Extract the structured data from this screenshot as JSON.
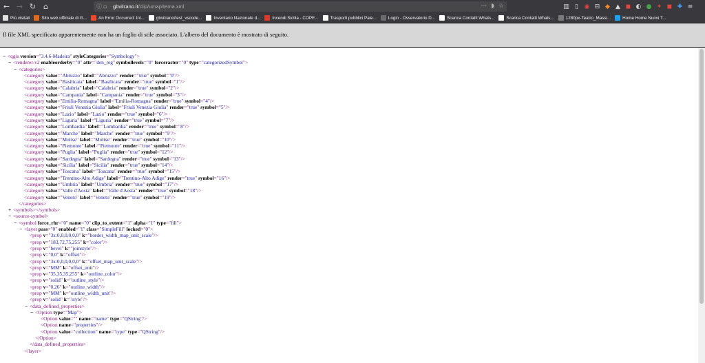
{
  "toolbar": {
    "url_domain": "gbvitrano.it",
    "url_path": "/clip/umap/tema.xml"
  },
  "bookmarks": [
    {
      "label": "Più visitati",
      "color": "#e1e1e1",
      "icon": "gear-icon"
    },
    {
      "label": "Sito web ufficiale di G...",
      "color": "#e06b1f",
      "icon": "site-icon"
    },
    {
      "label": "An Error Occurred: Int...",
      "color": "#e94b2c",
      "icon": "error-icon"
    },
    {
      "label": "gbvitrano/test_vscode...",
      "color": "#ffffff",
      "icon": "github-icon"
    },
    {
      "label": "Inventario Nazionale d...",
      "color": "#ffffff",
      "icon": "globe-icon"
    },
    {
      "label": "Incendi Sicilia - COPE...",
      "color": "#d93a2b",
      "icon": "fire-icon"
    },
    {
      "label": "Trasporti pubblici Pale...",
      "color": "#ffffff",
      "icon": "globe-icon"
    },
    {
      "label": "Login - Osservatorio D...",
      "color": "#6b6b6b",
      "icon": "page-icon"
    },
    {
      "label": "Scarica Contatti Whats...",
      "color": "#ffffff",
      "icon": "globe-icon"
    },
    {
      "label": "Scarica Contatti Whats...",
      "color": "#ffffff",
      "icon": "globe-icon"
    },
    {
      "label": "1280px-Teatro_Massi...",
      "color": "#7b7b7b",
      "icon": "image-icon"
    },
    {
      "label": "Home Home Nuovi T...",
      "color": "#1da1f2",
      "icon": "twitter-icon"
    }
  ],
  "infobar": {
    "message": "Il file XML specificato apparentemente non ha un foglio di stile associato. L'albero del documento è mostrato di seguito."
  },
  "xml": {
    "categories": [
      {
        "value": "Abruzzo",
        "symbol": "0"
      },
      {
        "value": "Basilicata",
        "symbol": "1"
      },
      {
        "value": "Calabria",
        "symbol": "2"
      },
      {
        "value": "Campania",
        "symbol": "3"
      },
      {
        "value": "Emilia-Romagna",
        "symbol": "4"
      },
      {
        "value": "Friuli Venezia Giulia",
        "symbol": "5"
      },
      {
        "value": "Lazio",
        "symbol": "6"
      },
      {
        "value": "Liguria",
        "symbol": "7"
      },
      {
        "value": "Lombardia",
        "symbol": "8"
      },
      {
        "value": "Marche",
        "symbol": "9"
      },
      {
        "value": "Molise",
        "symbol": "10"
      },
      {
        "value": "Piemonte",
        "symbol": "11"
      },
      {
        "value": "Puglia",
        "symbol": "12"
      },
      {
        "value": "Sardegna",
        "symbol": "13"
      },
      {
        "value": "Sicilia",
        "symbol": "14"
      },
      {
        "value": "Toscana",
        "symbol": "15"
      },
      {
        "value": "Trentino-Alto Adige",
        "symbol": "16"
      },
      {
        "value": "Umbria",
        "symbol": "17"
      },
      {
        "value": "Valle d'Aosta",
        "symbol": "18"
      },
      {
        "value": "Veneto",
        "symbol": "19"
      }
    ],
    "props": [
      {
        "v": "3x:0,0,0,0,0,0",
        "k": "border_width_map_unit_scale"
      },
      {
        "v": "183,72,75,255",
        "k": "color"
      },
      {
        "v": "bevel",
        "k": "joinstyle"
      },
      {
        "v": "0,0",
        "k": "offset"
      },
      {
        "v": "3x:0,0,0,0,0,0",
        "k": "offset_map_unit_scale"
      },
      {
        "v": "MM",
        "k": "offset_unit"
      },
      {
        "v": "35,35,35,255",
        "k": "outline_color"
      },
      {
        "v": "solid",
        "k": "outline_style"
      },
      {
        "v": "0.26",
        "k": "outline_width"
      },
      {
        "v": "MM",
        "k": "outline_width_unit"
      },
      {
        "v": "solid",
        "k": "style"
      }
    ],
    "lines": [
      {
        "indent": 0,
        "toggle": "−",
        "parts": [
          [
            "tg",
            "<qgis"
          ],
          [
            "an",
            " version"
          ],
          [
            "tg",
            "=\""
          ],
          [
            "av",
            "3.4.6-Madeira"
          ],
          [
            "tg",
            "\""
          ],
          [
            "an",
            " styleCategories"
          ],
          [
            "tg",
            "=\""
          ],
          [
            "av",
            "Symbology"
          ],
          [
            "tg",
            "\">"
          ]
        ]
      },
      {
        "indent": 1,
        "toggle": "−",
        "parts": [
          [
            "tg",
            "<renderer-v2"
          ],
          [
            "an",
            " enableorderby"
          ],
          [
            "tg",
            "=\""
          ],
          [
            "av",
            "0"
          ],
          [
            "tg",
            "\""
          ],
          [
            "an",
            " attr"
          ],
          [
            "tg",
            "=\""
          ],
          [
            "av",
            "den_reg"
          ],
          [
            "tg",
            "\""
          ],
          [
            "an",
            " symbollevels"
          ],
          [
            "tg",
            "=\""
          ],
          [
            "av",
            "0"
          ],
          [
            "tg",
            "\""
          ],
          [
            "an",
            " forceraster"
          ],
          [
            "tg",
            "=\""
          ],
          [
            "av",
            "0"
          ],
          [
            "tg",
            "\""
          ],
          [
            "an",
            " type"
          ],
          [
            "tg",
            "=\""
          ],
          [
            "av",
            "categorizedSymbol"
          ],
          [
            "tg",
            "\">"
          ]
        ]
      },
      {
        "indent": 2,
        "toggle": "−",
        "parts": [
          [
            "tg",
            "<categories>"
          ]
        ]
      },
      {
        "indent": 3,
        "kind": "categories"
      },
      {
        "indent": 2,
        "toggle": "",
        "parts": [
          [
            "tg",
            "</categories>"
          ]
        ]
      },
      {
        "indent": 1,
        "toggle": "+",
        "parts": [
          [
            "tg",
            "<symbols></symbols>"
          ]
        ]
      },
      {
        "indent": 1,
        "toggle": "−",
        "parts": [
          [
            "tg",
            "<source-symbol>"
          ]
        ]
      },
      {
        "indent": 2,
        "toggle": "−",
        "parts": [
          [
            "tg",
            "<symbol"
          ],
          [
            "an",
            " force_rhr"
          ],
          [
            "tg",
            "=\""
          ],
          [
            "av",
            "0"
          ],
          [
            "tg",
            "\""
          ],
          [
            "an",
            " name"
          ],
          [
            "tg",
            "=\""
          ],
          [
            "av",
            "0"
          ],
          [
            "tg",
            "\""
          ],
          [
            "an",
            " clip_to_extent"
          ],
          [
            "tg",
            "=\""
          ],
          [
            "av",
            "1"
          ],
          [
            "tg",
            "\""
          ],
          [
            "an",
            " alpha"
          ],
          [
            "tg",
            "=\""
          ],
          [
            "av",
            "1"
          ],
          [
            "tg",
            "\""
          ],
          [
            "an",
            " type"
          ],
          [
            "tg",
            "=\""
          ],
          [
            "av",
            "fill"
          ],
          [
            "tg",
            "\">"
          ]
        ]
      },
      {
        "indent": 3,
        "toggle": "−",
        "parts": [
          [
            "tg",
            "<layer"
          ],
          [
            "an",
            " pass"
          ],
          [
            "tg",
            "=\""
          ],
          [
            "av",
            "0"
          ],
          [
            "tg",
            "\""
          ],
          [
            "an",
            " enabled"
          ],
          [
            "tg",
            "=\""
          ],
          [
            "av",
            "1"
          ],
          [
            "tg",
            "\""
          ],
          [
            "an",
            " class"
          ],
          [
            "tg",
            "=\""
          ],
          [
            "av",
            "SimpleFill"
          ],
          [
            "tg",
            "\""
          ],
          [
            "an",
            " locked"
          ],
          [
            "tg",
            "=\""
          ],
          [
            "av",
            "0"
          ],
          [
            "tg",
            "\">"
          ]
        ]
      },
      {
        "indent": 4,
        "kind": "props"
      },
      {
        "indent": 4,
        "toggle": "−",
        "parts": [
          [
            "tg",
            "<data_defined_properties>"
          ]
        ]
      },
      {
        "indent": 5,
        "toggle": "−",
        "parts": [
          [
            "tg",
            "<Option"
          ],
          [
            "an",
            " type"
          ],
          [
            "tg",
            "=\""
          ],
          [
            "av",
            "Map"
          ],
          [
            "tg",
            "\">"
          ]
        ]
      },
      {
        "indent": 6,
        "toggle": "",
        "parts": [
          [
            "tg",
            "<Option"
          ],
          [
            "an",
            " value"
          ],
          [
            "tg",
            "=\""
          ],
          [
            "av",
            ""
          ],
          [
            "tg",
            "\""
          ],
          [
            "an",
            " name"
          ],
          [
            "tg",
            "=\""
          ],
          [
            "av",
            "name"
          ],
          [
            "tg",
            "\""
          ],
          [
            "an",
            " type"
          ],
          [
            "tg",
            "=\""
          ],
          [
            "av",
            "QString"
          ],
          [
            "tg",
            "\"/>"
          ]
        ]
      },
      {
        "indent": 6,
        "toggle": "",
        "parts": [
          [
            "tg",
            "<Option"
          ],
          [
            "an",
            " name"
          ],
          [
            "tg",
            "=\""
          ],
          [
            "av",
            "properties"
          ],
          [
            "tg",
            "\"/>"
          ]
        ]
      },
      {
        "indent": 6,
        "toggle": "",
        "parts": [
          [
            "tg",
            "<Option"
          ],
          [
            "an",
            " value"
          ],
          [
            "tg",
            "=\""
          ],
          [
            "av",
            "collection"
          ],
          [
            "tg",
            "\""
          ],
          [
            "an",
            " name"
          ],
          [
            "tg",
            "=\""
          ],
          [
            "av",
            "type"
          ],
          [
            "tg",
            "\""
          ],
          [
            "an",
            " type"
          ],
          [
            "tg",
            "=\""
          ],
          [
            "av",
            "QString"
          ],
          [
            "tg",
            "\"/>"
          ]
        ]
      },
      {
        "indent": 5,
        "toggle": "",
        "parts": [
          [
            "tg",
            "</Option>"
          ]
        ]
      },
      {
        "indent": 4,
        "toggle": "",
        "parts": [
          [
            "tg",
            "</data_defined_properties>"
          ]
        ]
      },
      {
        "indent": 3,
        "toggle": "",
        "parts": [
          [
            "tg",
            "</layer>"
          ]
        ]
      }
    ]
  }
}
